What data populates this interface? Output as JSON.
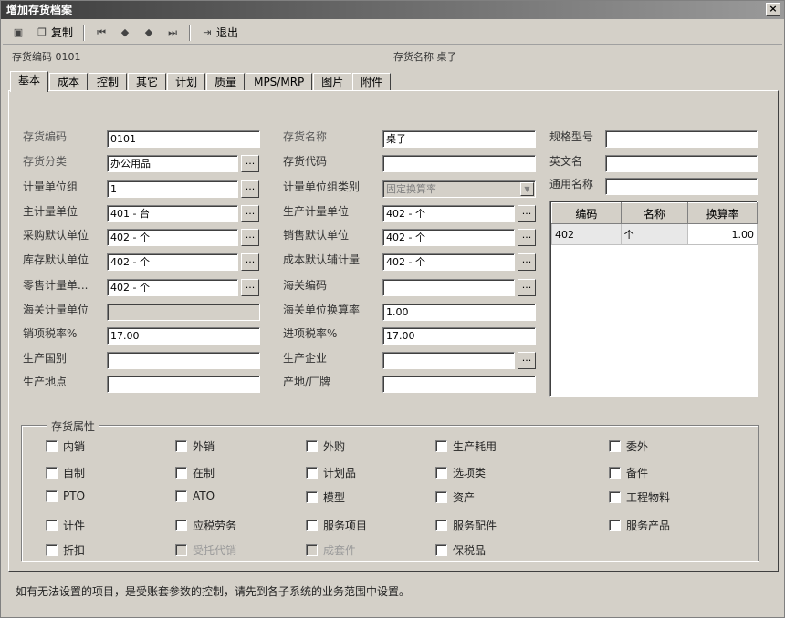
{
  "window": {
    "title": "增加存货档案",
    "close_label": "×"
  },
  "toolbar": {
    "copy_label": "复制",
    "exit_label": "退出"
  },
  "header": {
    "code_label": "存货编码 0101",
    "name_label": "存货名称 桌子"
  },
  "tabs": [
    "基本",
    "成本",
    "控制",
    "其它",
    "计划",
    "质量",
    "MPS/MRP",
    "图片",
    "附件"
  ],
  "form": {
    "inv_code": {
      "label": "存货编码",
      "value": "0101"
    },
    "inv_class": {
      "label": "存货分类",
      "value": "办公用品"
    },
    "uom_group": {
      "label": "计量单位组",
      "value": "1"
    },
    "main_uom": {
      "label": "主计量单位",
      "value": "401 - 台"
    },
    "purchase_uom": {
      "label": "采购默认单位",
      "value": "402 - 个"
    },
    "stock_uom": {
      "label": "库存默认单位",
      "value": "402 - 个"
    },
    "retail_uom": {
      "label": "零售计量单...",
      "value": "402 - 个"
    },
    "customs_uom": {
      "label": "海关计量单位",
      "value": ""
    },
    "sales_tax": {
      "label": "销项税率%",
      "value": "17.00"
    },
    "origin_country": {
      "label": "生产国别",
      "value": ""
    },
    "origin_place": {
      "label": "生产地点",
      "value": ""
    },
    "inv_name": {
      "label": "存货名称",
      "value": "桌子"
    },
    "inv_abbr": {
      "label": "存货代码",
      "value": ""
    },
    "uom_group_type": {
      "label": "计量单位组类别",
      "value": "固定换算率"
    },
    "production_uom": {
      "label": "生产计量单位",
      "value": "402 - 个"
    },
    "sales_uom": {
      "label": "销售默认单位",
      "value": "402 - 个"
    },
    "cost_uom": {
      "label": "成本默认辅计量",
      "value": "402 - 个"
    },
    "customs_code": {
      "label": "海关编码",
      "value": ""
    },
    "customs_rate": {
      "label": "海关单位换算率",
      "value": "1.00"
    },
    "input_tax": {
      "label": "进项税率%",
      "value": "17.00"
    },
    "manufacturer": {
      "label": "生产企业",
      "value": ""
    },
    "brand": {
      "label": "产地/厂牌",
      "value": ""
    },
    "spec": {
      "label": "规格型号",
      "value": ""
    },
    "english_name": {
      "label": "英文名",
      "value": ""
    },
    "common_name": {
      "label": "通用名称",
      "value": ""
    }
  },
  "grid": {
    "headers": [
      "编码",
      "名称",
      "换算率"
    ],
    "rows": [
      [
        "402",
        "个",
        "1.00"
      ]
    ]
  },
  "attributes": {
    "title": "存货属性",
    "items": {
      "c1": "内销",
      "c2": "外销",
      "c3": "外购",
      "c4": "生产耗用",
      "c5": "委外",
      "c6": "自制",
      "c7": "在制",
      "c8": "计划品",
      "c9": "选项类",
      "c10": "备件",
      "c11": "PTO",
      "c12": "ATO",
      "c13": "模型",
      "c14": "资产",
      "c15": "工程物料",
      "c16": "计件",
      "c17": "应税劳务",
      "c18": "服务项目",
      "c19": "服务配件",
      "c20": "服务产品",
      "c21": "折扣",
      "c22": "受托代销",
      "c23": "成套件",
      "c24": "保税品"
    }
  },
  "status": {
    "message": "如有无法设置的项目，是受账套参数的控制，请先到各子系统的业务范围中设置。"
  },
  "ref_button_label": "...",
  "icons": [
    "save-icon",
    "copy-icon",
    "first-icon",
    "prev-icon",
    "next-icon",
    "last-icon",
    "exit-icon",
    "dropdown-arrow-icon"
  ]
}
